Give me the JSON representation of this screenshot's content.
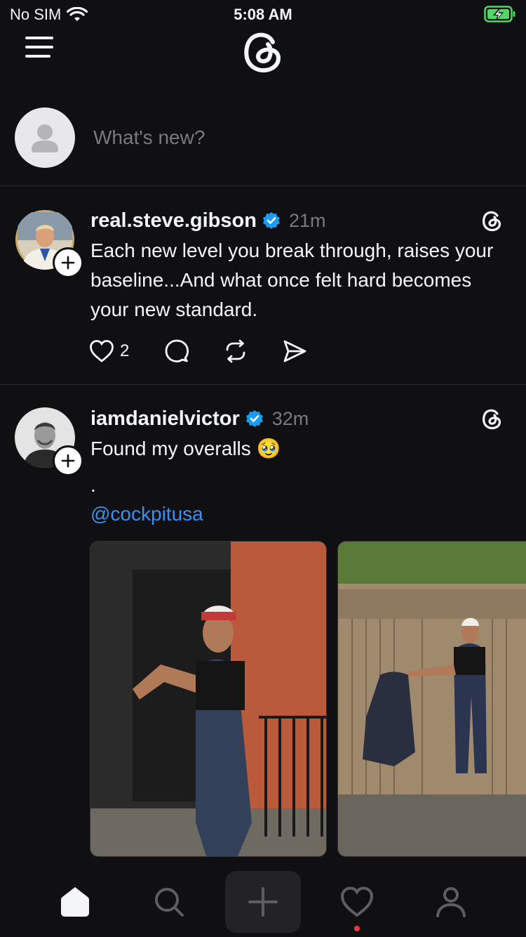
{
  "status_bar": {
    "carrier": "No SIM",
    "time": "5:08 AM"
  },
  "composer": {
    "placeholder": "What's new?"
  },
  "posts": [
    {
      "username": "real.steve.gibson",
      "time": "21m",
      "text": "Each new level you break through, raises your baseline...And what once felt hard becomes your new standard.",
      "likes": "2"
    },
    {
      "username": "iamdanielvictor",
      "time": "32m",
      "text_line1": "Found my overalls 🥹",
      "text_line2": ".",
      "mention": "@cockpitusa"
    }
  ],
  "icons": {
    "menu": "menu-icon",
    "logo": "threads-logo",
    "verified": "verified-badge-icon",
    "like": "heart-icon",
    "reply": "comment-icon",
    "repost": "repost-icon",
    "share": "send-icon",
    "home": "home-icon",
    "search": "search-icon",
    "create": "plus-icon",
    "activity": "heart-icon",
    "profile": "person-icon"
  },
  "colors": {
    "background": "#101012",
    "text": "#f3f5f7",
    "muted": "#7a7a7d",
    "link": "#3b8ff0",
    "verified": "#1d9bf0",
    "notification": "#ff3040",
    "battery": "#4cd964"
  }
}
